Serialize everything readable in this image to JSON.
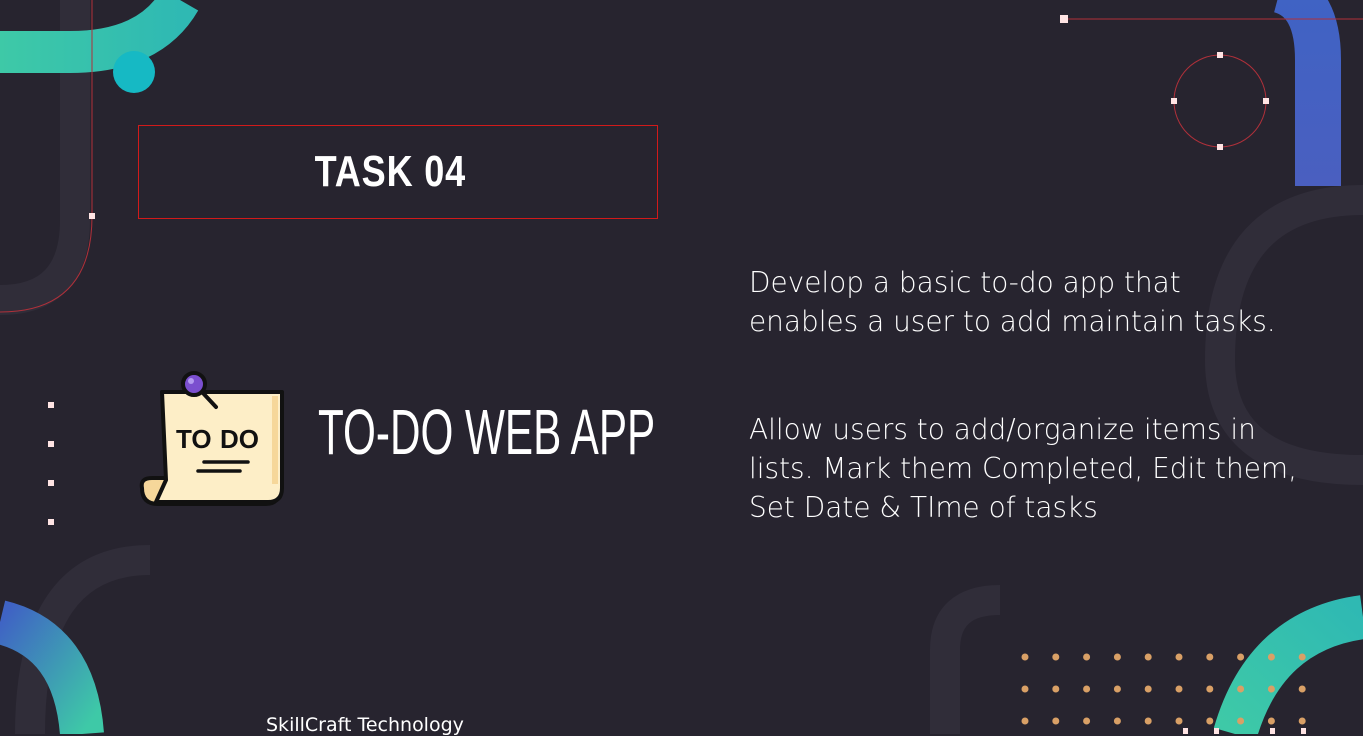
{
  "slide": {
    "task_label": "TASK 04",
    "app_title": "TO-DO WEB APP",
    "description_paragraph_1": "Develop a basic to-do app that enables a user to add maintain tasks.",
    "description_paragraph_2": "Allow users to add/organize items in lists. Mark them Completed, Edit them, Set Date & TIme of tasks",
    "footer": "SkillCraft Technology"
  },
  "icon": {
    "name": "todo-note-icon",
    "note_text_1": "TO",
    "note_text_2": "DO"
  },
  "colors": {
    "background": "#27242f",
    "accent_red": "#d21a1a",
    "teal_gradient_start": "#3ec9a7",
    "blue_gradient_end": "#4169c7",
    "dot_orange": "#d9a066",
    "note_paper": "#fdeec7",
    "pin_purple": "#7b4fcf"
  }
}
